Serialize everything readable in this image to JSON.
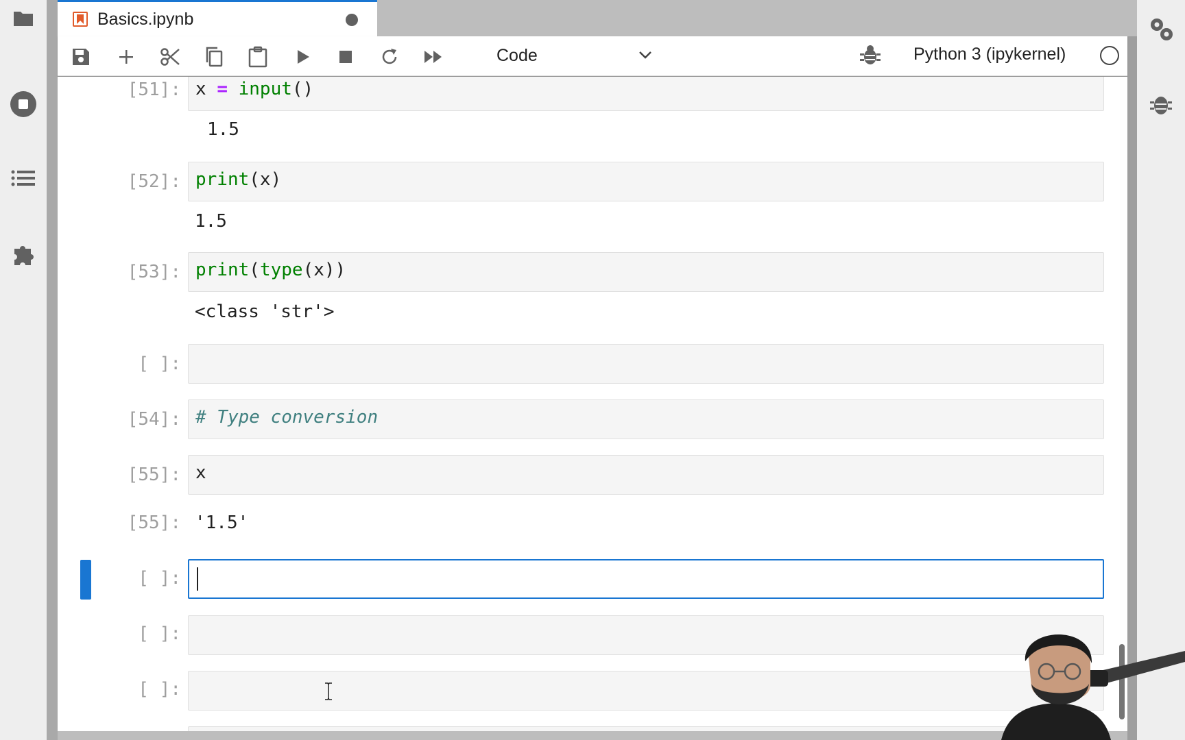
{
  "tab": {
    "title": "Basics.ipynb"
  },
  "toolbar": {
    "cell_type": "Code",
    "kernel": "Python 3 (ipykernel)"
  },
  "cells": [
    {
      "prompt": "[51]:",
      "code": "x = input()",
      "output": "1.5"
    },
    {
      "prompt": "[52]:",
      "code": "print(x)",
      "output": "1.5"
    },
    {
      "prompt": "[53]:",
      "code": "print(type(x))",
      "output": "<class 'str'>"
    },
    {
      "prompt": "[ ]:",
      "code": ""
    },
    {
      "prompt": "[54]:",
      "code": "# Type conversion"
    },
    {
      "prompt": "[55]:",
      "code": "x",
      "output_prompt": "[55]:",
      "output": "'1.5'"
    },
    {
      "prompt": "[ ]:",
      "code": "",
      "active": true
    },
    {
      "prompt": "[ ]:",
      "code": ""
    },
    {
      "prompt": "[ ]:",
      "code": ""
    }
  ],
  "code_tokens": {
    "c0": {
      "a": "x ",
      "op": "=",
      "fn": "input",
      "b": "()"
    },
    "c1": {
      "fn": "print",
      "b": "(x)"
    },
    "c2": {
      "fn": "print",
      "b1": "(",
      "fn2": "type",
      "b2": "(x))"
    }
  },
  "colors": {
    "accent": "#1976d2",
    "builtin": "#008000",
    "operator": "#aa22ff",
    "comment": "#408080",
    "file_icon": "#e15b2b"
  },
  "icons": [
    "folder-icon",
    "running-icon",
    "toc-icon",
    "extension-icon",
    "property-inspector-icon",
    "debugger-icon",
    "save-icon",
    "add-cell-icon",
    "cut-icon",
    "copy-icon",
    "paste-icon",
    "run-icon",
    "stop-icon",
    "restart-icon",
    "run-all-icon",
    "chevron-down-icon",
    "bug-icon",
    "kernel-idle-icon"
  ]
}
